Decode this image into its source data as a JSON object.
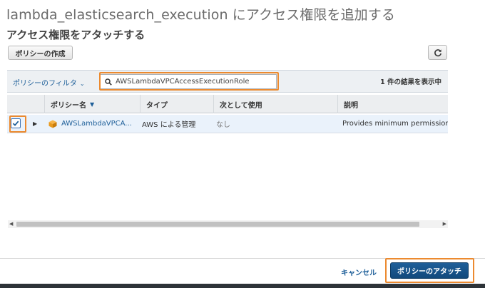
{
  "header": {
    "title": "lambda_elasticsearch_execution にアクセス権限を追加する",
    "subtitle": "アクセス権限をアタッチする"
  },
  "toolbar": {
    "create_policy_label": "ポリシーの作成",
    "refresh_icon": "refresh-icon"
  },
  "filter": {
    "filter_label": "ポリシーのフィルタ",
    "search_value": "AWSLambdaVPCAccessExecutionRole",
    "result_count": "1 件の結果を表示中"
  },
  "table": {
    "columns": [
      "ポリシー名",
      "タイプ",
      "次として使用",
      "説明"
    ],
    "rows": [
      {
        "checked": true,
        "name": "AWSLambdaVPCA...",
        "type": "AWS による管理",
        "used_as": "なし",
        "description": "Provides minimum permissions fo"
      }
    ]
  },
  "footer": {
    "cancel_label": "キャンセル",
    "attach_label": "ポリシーのアタッチ"
  },
  "colors": {
    "accent": "#1e5f99",
    "highlight": "#ec8a2f",
    "row_selected": "#eaf2fb"
  }
}
